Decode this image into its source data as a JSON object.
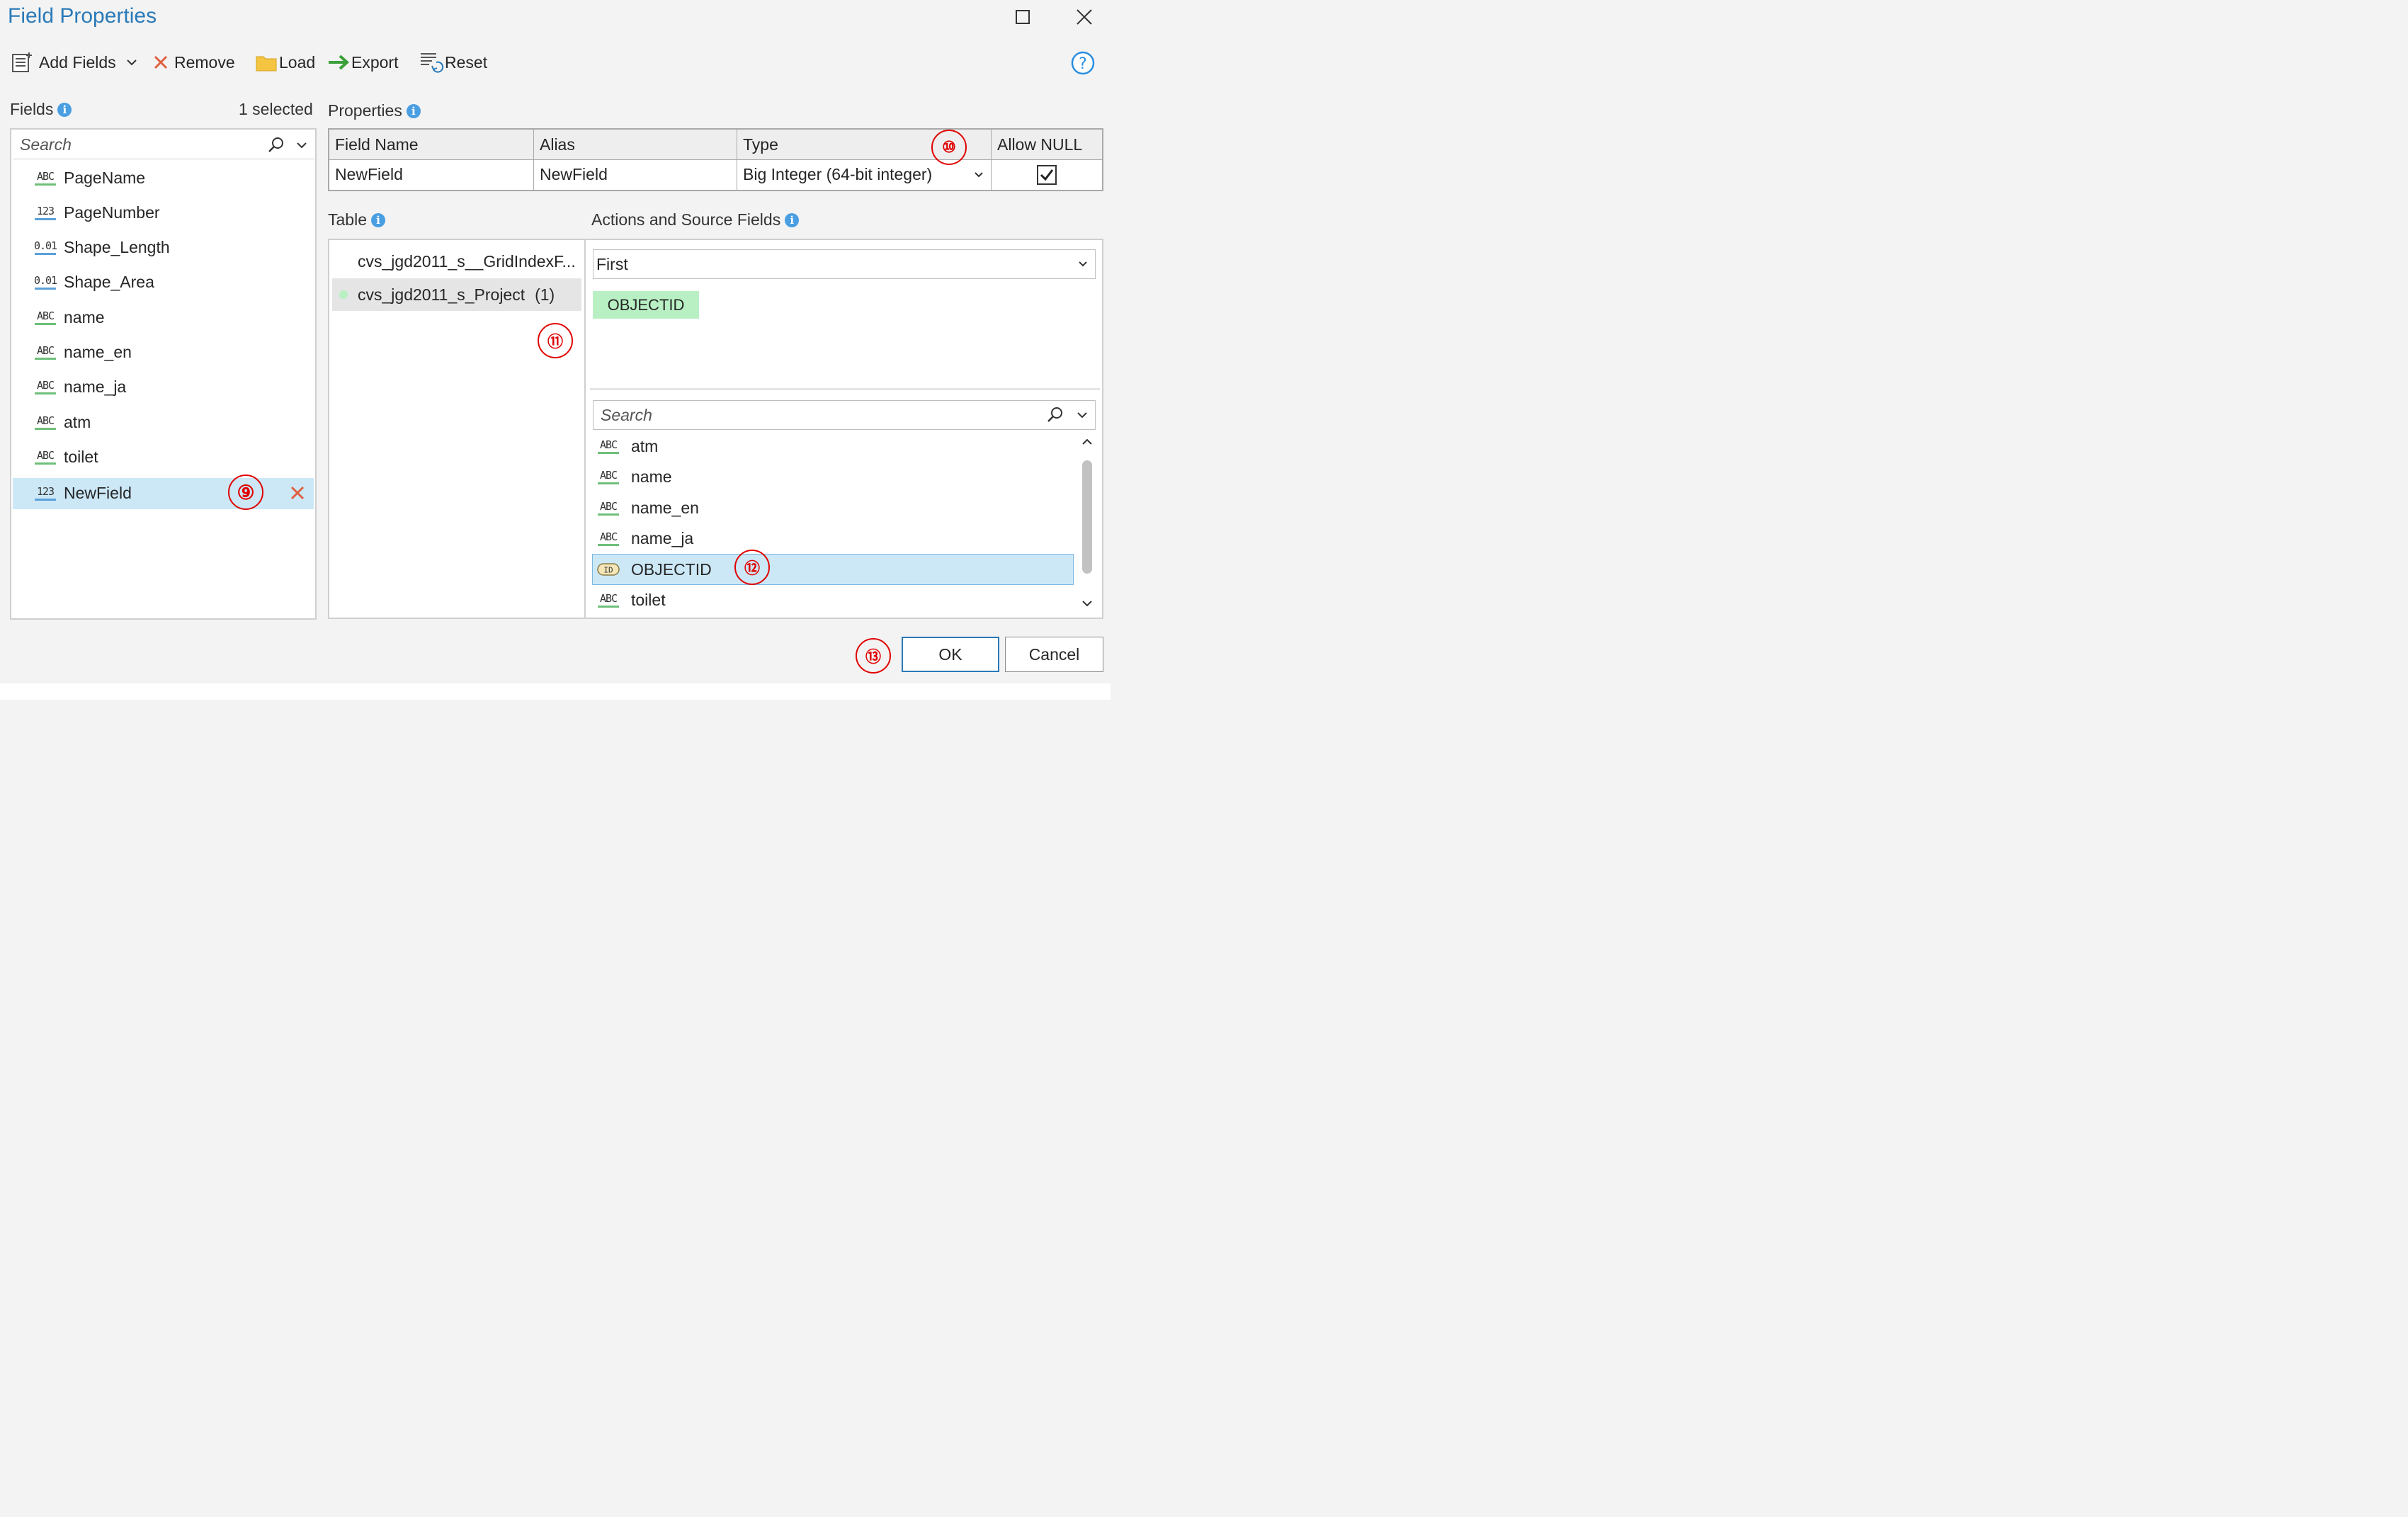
{
  "window": {
    "title": "Field Properties"
  },
  "toolbar": {
    "add_fields": "Add Fields",
    "remove": "Remove",
    "load": "Load",
    "export": "Export",
    "reset": "Reset"
  },
  "fields_panel": {
    "label": "Fields",
    "selected_count": "1 selected",
    "search_placeholder": "Search",
    "items": [
      {
        "type": "ABC",
        "name": "PageName"
      },
      {
        "type": "123",
        "name": "PageNumber"
      },
      {
        "type": "0.01",
        "name": "Shape_Length"
      },
      {
        "type": "0.01",
        "name": "Shape_Area"
      },
      {
        "type": "ABC",
        "name": "name"
      },
      {
        "type": "ABC",
        "name": "name_en"
      },
      {
        "type": "ABC",
        "name": "name_ja"
      },
      {
        "type": "ABC",
        "name": "atm"
      },
      {
        "type": "ABC",
        "name": "toilet"
      },
      {
        "type": "123",
        "name": "NewField",
        "selected": true
      }
    ]
  },
  "properties": {
    "label": "Properties",
    "headers": [
      "Field Name",
      "Alias",
      "Type",
      "Allow NULL"
    ],
    "row": {
      "field_name": "NewField",
      "alias": "NewField",
      "type": "Big Integer (64-bit integer)",
      "allow_null": true
    }
  },
  "table_panel": {
    "label": "Table",
    "items": [
      {
        "name": "cvs_jgd2011_s__GridIndexF..."
      },
      {
        "name": "cvs_jgd2011_s_Project",
        "count": "(1)",
        "selected": true
      }
    ]
  },
  "actions_panel": {
    "label": "Actions and Source Fields",
    "action": "First",
    "chip": "OBJECTID",
    "search_placeholder": "Search",
    "source_fields": [
      {
        "type": "ABC",
        "name": "atm"
      },
      {
        "type": "ABC",
        "name": "name"
      },
      {
        "type": "ABC",
        "name": "name_en"
      },
      {
        "type": "ABC",
        "name": "name_ja"
      },
      {
        "type": "ID",
        "name": "OBJECTID",
        "selected": true
      },
      {
        "type": "ABC",
        "name": "toilet"
      }
    ]
  },
  "buttons": {
    "ok": "OK",
    "cancel": "Cancel"
  },
  "annotations": [
    "⑨",
    "⑩",
    "⑪",
    "⑫",
    "⑬"
  ],
  "colors": {
    "accent": "#2a7ab8",
    "selection": "#cce8f7",
    "chip": "#b8f0c4",
    "annotation": "#e10000",
    "remove_x": "#e06040"
  }
}
